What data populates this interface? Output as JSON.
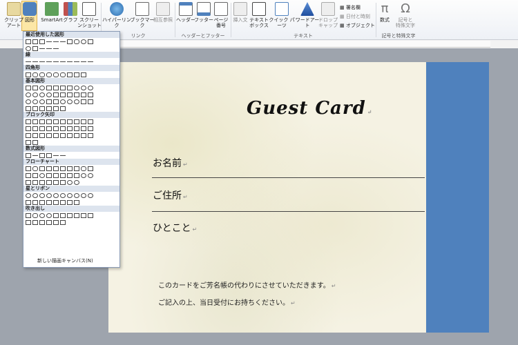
{
  "ribbon": {
    "buttons": [
      {
        "label": "クリップ\nアート"
      },
      {
        "label": "図形"
      },
      {
        "label": "SmartArt"
      },
      {
        "label": "グラフ"
      },
      {
        "label": "スクリー\nンショット"
      },
      {
        "label": "ハイパーリンク"
      },
      {
        "label": "ブックマーク"
      },
      {
        "label": "相互参照"
      },
      {
        "label": "ヘッダー"
      },
      {
        "label": "フッター"
      },
      {
        "label": "ページ\n番号"
      },
      {
        "label": "挿入文"
      },
      {
        "label": "テキスト\nボックス"
      },
      {
        "label": "クイック パーツ"
      },
      {
        "label": "ワードアート"
      },
      {
        "label": "ドロップ\nキャップ"
      },
      {
        "label": "数式"
      },
      {
        "label": "記号と\n特殊文字"
      }
    ],
    "small_items": [
      "署名欄",
      "日付と時刻",
      "オブジェクト"
    ],
    "groups": [
      "リンク",
      "ヘッダーとフッター",
      "テキスト",
      "記号と特殊文字"
    ]
  },
  "shapes_panel": {
    "sections": [
      "最近使用した図形",
      "線",
      "四角形",
      "基本図形",
      "ブロック矢印",
      "数式図形",
      "フローチャート",
      "星とリボン",
      "吹き出し"
    ],
    "new_canvas": "新しい描画キャンバス(N)"
  },
  "document": {
    "title": "Guest Card",
    "fields": [
      "お名前",
      "ご住所",
      "ひとこと"
    ],
    "notes": [
      "このカードをご芳名帳の代わりにさせていただきます。",
      "ご記入の上、当日受付にお持ちください。"
    ],
    "return_mark": "↵"
  },
  "colors": {
    "accent_bar": "#4f81bd",
    "paper": "#f5f2e3"
  }
}
